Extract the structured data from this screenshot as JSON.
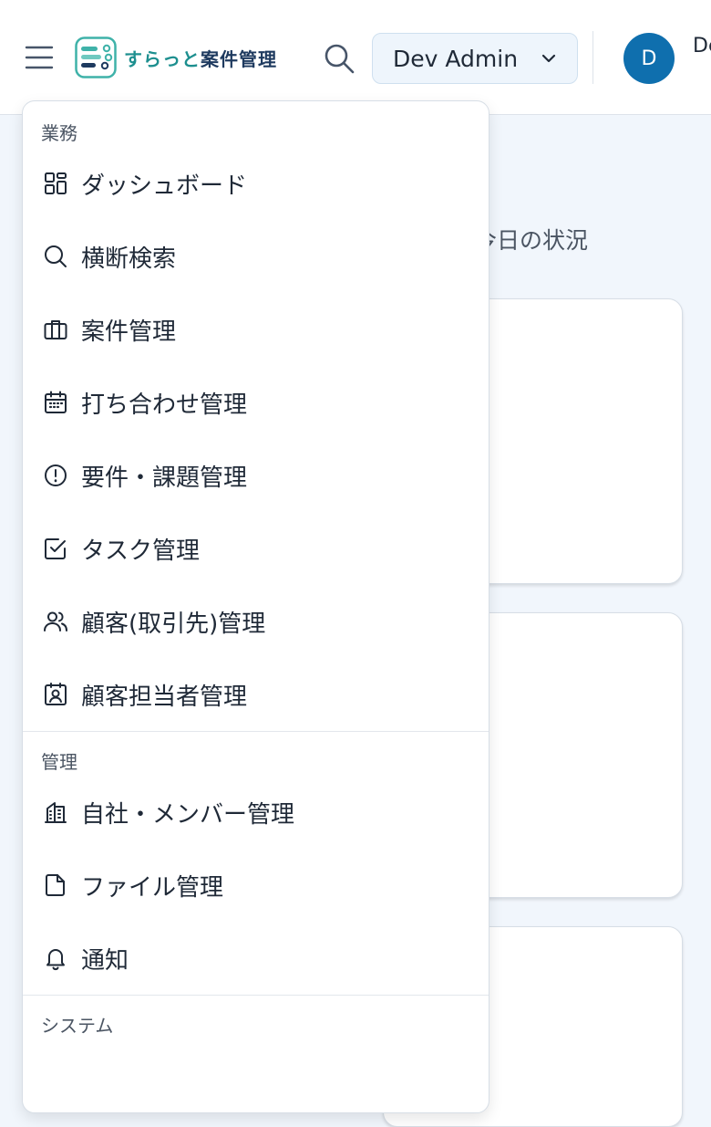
{
  "header": {
    "logo_text_accent": "すらっと",
    "logo_text_main": "案件管理",
    "org_select_value": "Dev Admin",
    "avatar_initial": "D",
    "user_name": "Dev Admin",
    "colors": {
      "brand_teal": "#1d8f8f",
      "avatar_bg": "#0f6fae",
      "page_bg": "#f1f6fc"
    }
  },
  "main": {
    "heading": "今日の状況"
  },
  "menu": {
    "sections": [
      {
        "title": "業務",
        "items": [
          {
            "label": "ダッシュボード",
            "icon": "dashboard-icon"
          },
          {
            "label": "横断検索",
            "icon": "search-icon"
          },
          {
            "label": "案件管理",
            "icon": "briefcase-icon"
          },
          {
            "label": "打ち合わせ管理",
            "icon": "calendar-icon"
          },
          {
            "label": "要件・課題管理",
            "icon": "exclamation-circle-icon"
          },
          {
            "label": "タスク管理",
            "icon": "checkbox-icon"
          },
          {
            "label": "顧客(取引先)管理",
            "icon": "users-icon"
          },
          {
            "label": "顧客担当者管理",
            "icon": "contact-card-icon"
          }
        ]
      },
      {
        "title": "管理",
        "items": [
          {
            "label": "自社・メンバー管理",
            "icon": "building-icon"
          },
          {
            "label": "ファイル管理",
            "icon": "document-icon"
          },
          {
            "label": "通知",
            "icon": "bell-icon"
          }
        ]
      },
      {
        "title": "システム",
        "items": []
      }
    ]
  }
}
